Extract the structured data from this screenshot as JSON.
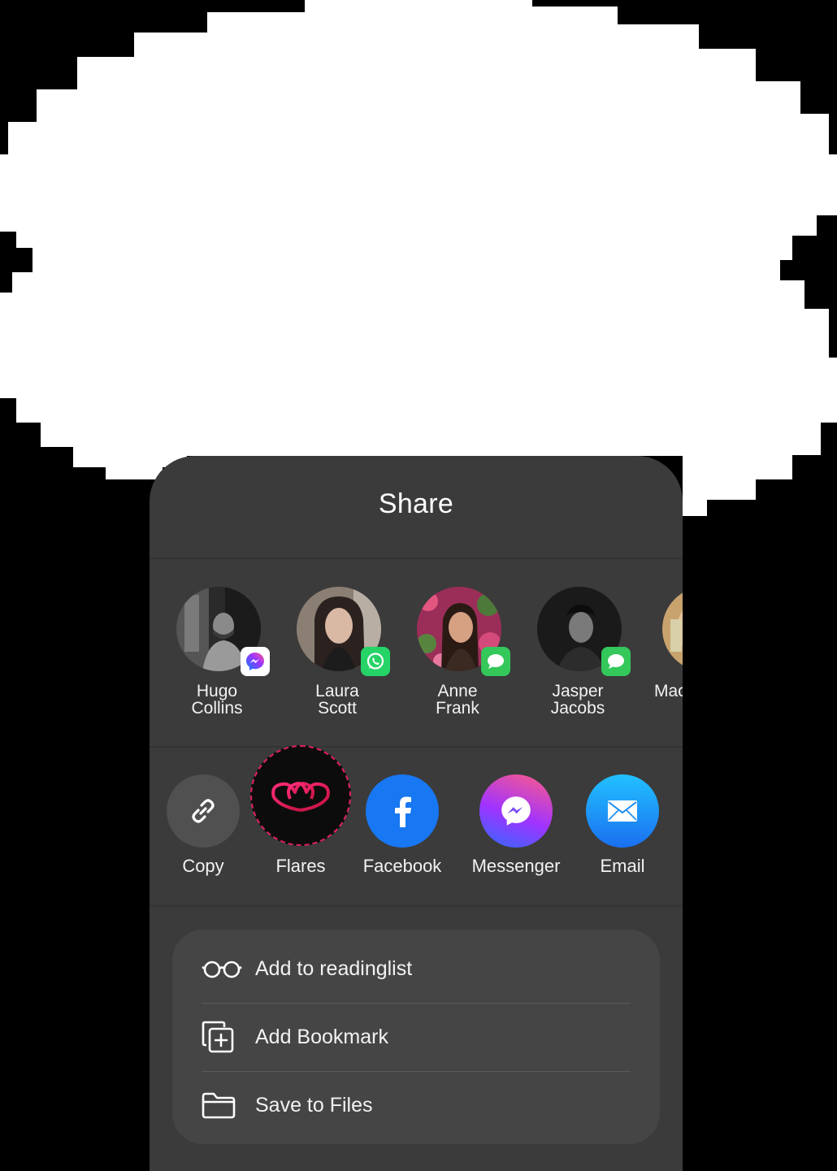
{
  "share_sheet": {
    "title": "Share",
    "contacts": [
      {
        "name_line1": "Hugo",
        "name_line2": "Collins",
        "app": "messenger-icon"
      },
      {
        "name_line1": "Laura",
        "name_line2": "Scott",
        "app": "whatsapp-icon"
      },
      {
        "name_line1": "Anne",
        "name_line2": "Frank",
        "app": "messages-icon"
      },
      {
        "name_line1": "Jasper",
        "name_line2": "Jacobs",
        "app": "messages-icon"
      },
      {
        "name_line1": "Mac",
        "name_line2": ""
      }
    ],
    "actions": [
      {
        "label": "Copy",
        "icon": "link-icon"
      },
      {
        "label": "Flares",
        "icon": "flares-logo-icon"
      },
      {
        "label": "Facebook",
        "icon": "facebook-icon"
      },
      {
        "label": "Messenger",
        "icon": "messenger-icon"
      },
      {
        "label": "Email",
        "icon": "envelope-icon"
      }
    ],
    "options": [
      {
        "label": "Add to readinglist",
        "icon": "glasses-icon"
      },
      {
        "label": "Add Bookmark",
        "icon": "bookmark-add-icon"
      },
      {
        "label": "Save to Files",
        "icon": "folder-icon"
      }
    ]
  },
  "colors": {
    "sheet_bg": "#3b3b3b",
    "options_bg": "#454545",
    "facebook": "#1877f2",
    "flares_accent": "#e0205f",
    "whatsapp": "#25d366",
    "messages": "#34c759"
  }
}
